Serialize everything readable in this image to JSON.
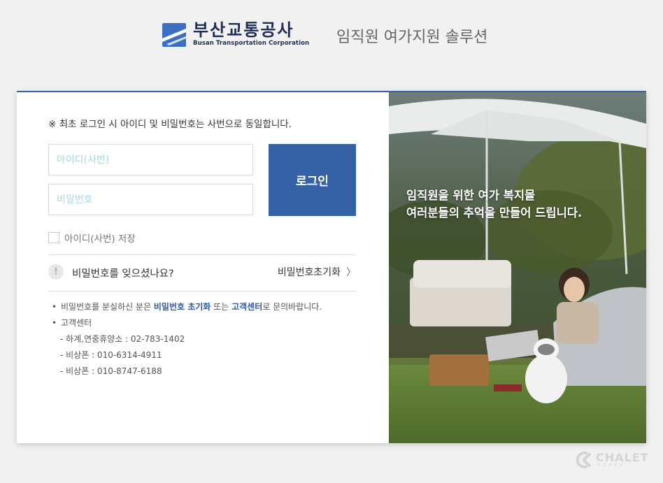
{
  "header": {
    "org_name_ko": "부산교통공사",
    "org_name_en": "Busan Transportation Corporation",
    "subtitle": "임직원 여가지원 솔루션"
  },
  "login": {
    "notice": "※ 최초 로그인 시 아이디 및 비밀번호는 사번으로 동일합니다.",
    "id_placeholder": "아이디(사번)",
    "pw_placeholder": "비밀번호",
    "login_button": "로그인",
    "save_id_label": "아이디(사번) 저장",
    "forgot_question": "비밀번호를 잊으셨나요?",
    "reset_link": "비밀번호초기화"
  },
  "info": {
    "lost_prefix": "비밀번호를 분실하신 분은 ",
    "lost_link1": "비밀번호 초기화",
    "lost_mid": " 또는 ",
    "lost_link2": "고객센터",
    "lost_suffix": "로 문의바랍니다.",
    "cs_title": "고객센터",
    "cs_lines": [
      "- 하계,연중휴양소 : 02-783-1402",
      "- 비상폰 : 010-6314-4911",
      "- 비상폰 : 010-8747-6188"
    ]
  },
  "promo": {
    "line1": "임직원을 위한 여가 복지몰",
    "line2": "여러분들의 추억을 만들어 드립니다."
  },
  "watermark": {
    "brand": "CHALET",
    "sub": "KOREA"
  },
  "colors": {
    "accent": "#3561a7",
    "logo_navy": "#1f2d57",
    "link": "#2f5aa2"
  }
}
